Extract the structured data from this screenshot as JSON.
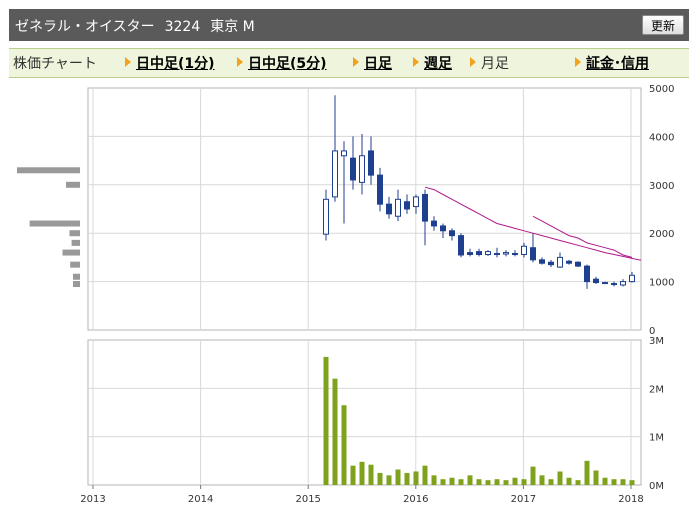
{
  "header": {
    "company": "ゼネラル・オイスター",
    "code": "3224",
    "market": "東京 M",
    "refresh_label": "更新"
  },
  "nav": {
    "label": "株価チャート",
    "tabs": [
      {
        "label": "日中足(1分)",
        "link": true
      },
      {
        "label": "日中足(5分)",
        "link": true
      },
      {
        "label": "日足",
        "link": true
      },
      {
        "label": "週足",
        "link": true
      },
      {
        "label": "月足",
        "link": false
      }
    ],
    "right_link": "証金･信用"
  },
  "colors": {
    "candle_down": "#1f3f8f",
    "candle_up": "#ffffff",
    "ma_line": "#b0188a",
    "volume_bar": "#7fa21c",
    "volume_profile": "#999999",
    "grid": "#d8d8d8"
  },
  "chart_data": [
    {
      "type": "candlestick",
      "x_ticks": [
        "2013",
        "2014",
        "2015",
        "2016",
        "2017",
        "2018"
      ],
      "y_ticks": [
        "0",
        "1000",
        "2000",
        "3000",
        "4000",
        "5000"
      ],
      "ylim": [
        0,
        5000
      ],
      "candles": [
        {
          "o": 1980,
          "h": 2900,
          "l": 1850,
          "c": 2700
        },
        {
          "o": 2750,
          "h": 4850,
          "l": 2650,
          "c": 3700
        },
        {
          "o": 3600,
          "h": 3900,
          "l": 2200,
          "c": 3700
        },
        {
          "o": 3550,
          "h": 4000,
          "l": 2900,
          "c": 3100
        },
        {
          "o": 3050,
          "h": 4050,
          "l": 2800,
          "c": 3600
        },
        {
          "o": 3700,
          "h": 4000,
          "l": 3000,
          "c": 3200
        },
        {
          "o": 3200,
          "h": 3350,
          "l": 2450,
          "c": 2600
        },
        {
          "o": 2600,
          "h": 2750,
          "l": 2300,
          "c": 2400
        },
        {
          "o": 2350,
          "h": 2900,
          "l": 2250,
          "c": 2700
        },
        {
          "o": 2650,
          "h": 2800,
          "l": 2400,
          "c": 2500
        },
        {
          "o": 2550,
          "h": 2800,
          "l": 2400,
          "c": 2750
        },
        {
          "o": 2800,
          "h": 2900,
          "l": 1750,
          "c": 2250
        },
        {
          "o": 2250,
          "h": 2350,
          "l": 2050,
          "c": 2150
        },
        {
          "o": 2150,
          "h": 2200,
          "l": 1900,
          "c": 2050
        },
        {
          "o": 2050,
          "h": 2100,
          "l": 1850,
          "c": 1950
        },
        {
          "o": 1950,
          "h": 2000,
          "l": 1500,
          "c": 1550
        },
        {
          "o": 1600,
          "h": 1680,
          "l": 1520,
          "c": 1560
        },
        {
          "o": 1620,
          "h": 1680,
          "l": 1520,
          "c": 1560
        },
        {
          "o": 1560,
          "h": 1650,
          "l": 1530,
          "c": 1620
        },
        {
          "o": 1580,
          "h": 1700,
          "l": 1500,
          "c": 1560
        },
        {
          "o": 1570,
          "h": 1650,
          "l": 1520,
          "c": 1600
        },
        {
          "o": 1580,
          "h": 1650,
          "l": 1520,
          "c": 1560
        },
        {
          "o": 1560,
          "h": 1800,
          "l": 1500,
          "c": 1730
        },
        {
          "o": 1700,
          "h": 2000,
          "l": 1400,
          "c": 1450
        },
        {
          "o": 1450,
          "h": 1500,
          "l": 1350,
          "c": 1380
        },
        {
          "o": 1400,
          "h": 1450,
          "l": 1300,
          "c": 1350
        },
        {
          "o": 1300,
          "h": 1600,
          "l": 1280,
          "c": 1500
        },
        {
          "o": 1420,
          "h": 1450,
          "l": 1350,
          "c": 1380
        },
        {
          "o": 1400,
          "h": 1420,
          "l": 1300,
          "c": 1320
        },
        {
          "o": 1320,
          "h": 1350,
          "l": 850,
          "c": 1000
        },
        {
          "o": 1050,
          "h": 1100,
          "l": 950,
          "c": 980
        },
        {
          "o": 980,
          "h": 1000,
          "l": 950,
          "c": 970
        },
        {
          "o": 960,
          "h": 1000,
          "l": 900,
          "c": 940
        },
        {
          "o": 930,
          "h": 1050,
          "l": 900,
          "c": 1000
        },
        {
          "o": 1000,
          "h": 1200,
          "l": 980,
          "c": 1130
        }
      ],
      "moving_averages": [
        {
          "start_index": 11,
          "values": [
            2950,
            2900,
            2800,
            2700,
            2600,
            2500,
            2400,
            2300,
            2200,
            2150,
            2100,
            2050,
            2000,
            1950,
            1900,
            1850,
            1800,
            1750,
            1700,
            1650,
            1600,
            1560,
            1520,
            1480,
            1440
          ]
        },
        {
          "start_index": 23,
          "values": [
            2350,
            2250,
            2150,
            2050,
            1950,
            1900,
            1800,
            1750,
            1700,
            1650,
            1550,
            1500
          ]
        }
      ],
      "volume_profile": [
        {
          "price": 3300,
          "volume": 0.9
        },
        {
          "price": 3000,
          "volume": 0.2
        },
        {
          "price": 2200,
          "volume": 0.72
        },
        {
          "price": 2000,
          "volume": 0.15
        },
        {
          "price": 1800,
          "volume": 0.12
        },
        {
          "price": 1600,
          "volume": 0.25
        },
        {
          "price": 1350,
          "volume": 0.14
        },
        {
          "price": 1100,
          "volume": 0.1
        },
        {
          "price": 950,
          "volume": 0.1
        }
      ]
    },
    {
      "type": "bar",
      "y_ticks": [
        "0M",
        "1M",
        "2M",
        "3M"
      ],
      "ylim": [
        0,
        3000000
      ],
      "values": [
        2650000,
        2200000,
        1650000,
        400000,
        480000,
        420000,
        250000,
        200000,
        320000,
        250000,
        280000,
        400000,
        200000,
        120000,
        150000,
        120000,
        200000,
        120000,
        100000,
        120000,
        100000,
        150000,
        120000,
        380000,
        200000,
        120000,
        280000,
        150000,
        100000,
        500000,
        300000,
        150000,
        120000,
        120000,
        100000
      ]
    }
  ]
}
